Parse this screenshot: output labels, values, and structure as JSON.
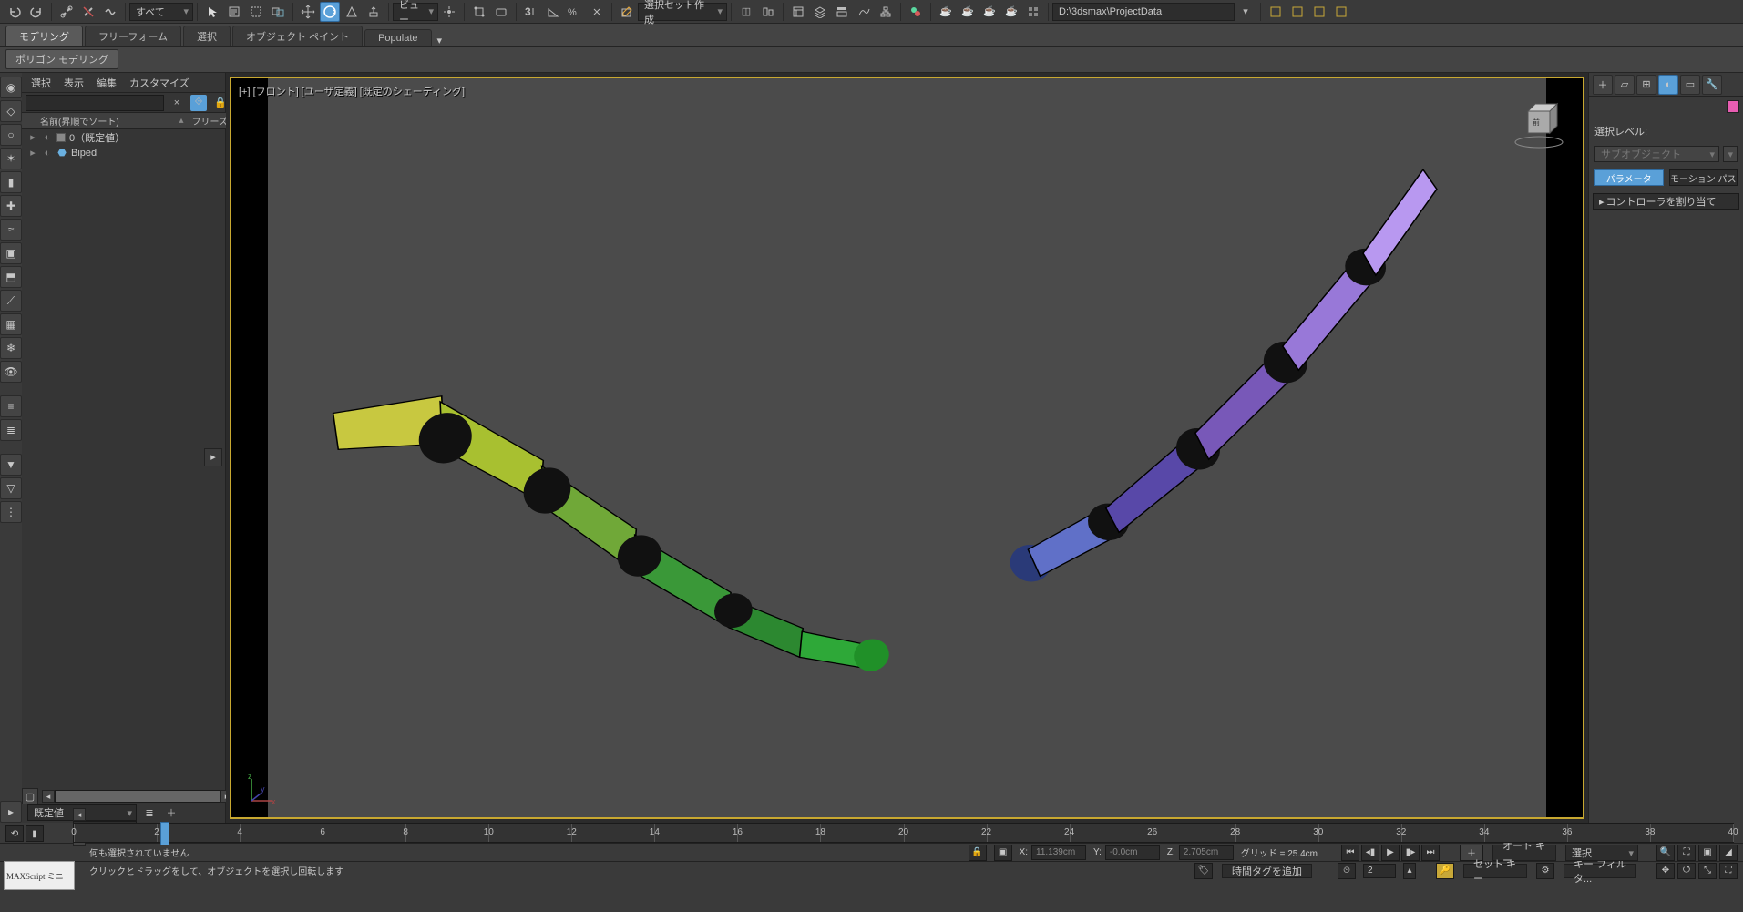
{
  "toolbar_top": {
    "dropdown_all": "すべて",
    "view_dd": "ビュー",
    "sel_set": "選択セット作成",
    "project_path": "D:\\3dsmax\\ProjectData"
  },
  "ribbon": {
    "tabs": [
      "モデリング",
      "フリーフォーム",
      "選択",
      "オブジェクト ペイント",
      "Populate"
    ],
    "subtab": "ポリゴン モデリング"
  },
  "scene_explorer": {
    "menus": [
      "選択",
      "表示",
      "編集",
      "カスタマイズ"
    ],
    "header_col": "名前(昇順でソート)",
    "header_freeze": "フリーズ",
    "items": [
      {
        "label": "0（既定値）",
        "indent": 0,
        "icon": "layer"
      },
      {
        "label": "Biped",
        "indent": 0,
        "icon": "biped"
      }
    ]
  },
  "viewport": {
    "label": "[+]  [フロント]  [ユーザ定義]  [既定のシェーディング]"
  },
  "right_panel": {
    "sel_level_label": "選択レベル:",
    "subobject": "サブオブジェクト",
    "param_btn": "パラメータ",
    "motion_path_btn": "モーション パス",
    "rollout_assign": "コントローラを割り当て"
  },
  "bottom": {
    "layer_default": "既定値",
    "frame_display": "2 / 40",
    "ruler_ticks": [
      0,
      2,
      4,
      6,
      8,
      10,
      12,
      14,
      16,
      18,
      20,
      22,
      24,
      26,
      28,
      30,
      32,
      34,
      36,
      38,
      40
    ],
    "current_frame_pos_pct": 5.5,
    "status_nosel": "何も選択されていません",
    "status_hint": "クリックとドラッグをして、オブジェクトを選択し回転します",
    "maxscript": "MAXScript ミニ",
    "coord": {
      "x_label": "X:",
      "x_val": "11.139cm",
      "y_label": "Y:",
      "y_val": "-0.0cm",
      "z_label": "Z:",
      "z_val": "2.705cm"
    },
    "grid": "グリッド = 25.4cm",
    "time_tag_btn": "時間タグを追加",
    "autokey": "オート キー",
    "setkey": "セット キー",
    "sel_dd": "選択",
    "keyfilter": "キー フィルタ...",
    "spinner_val": "2"
  }
}
